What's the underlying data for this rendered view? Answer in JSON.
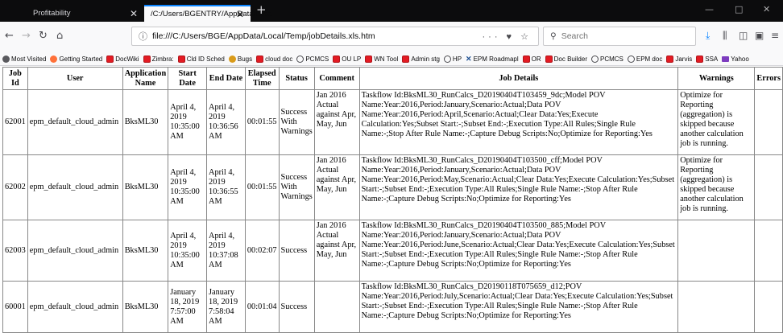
{
  "browser": {
    "tabs": [
      {
        "title": "Profitability"
      },
      {
        "title": "/C:/Users/BGENTRY/AppData/Loca"
      }
    ],
    "new_tab": "+",
    "window_controls": {
      "minimize": "—",
      "maximize": "□",
      "close": "✕"
    },
    "url": "file:///C:/Users/BGE/AppData/Local/Temp/jobDetails.xls.htm",
    "url_actions": "··· ♥ ☆",
    "search_placeholder": "Search",
    "accent": "#0a84ff"
  },
  "bookmarks": [
    {
      "label": "Most Visited",
      "icon": "gear-icon"
    },
    {
      "label": "Getting Started",
      "icon": "firefox-icon"
    },
    {
      "label": "DocWiki",
      "icon": "red-folder-icon"
    },
    {
      "label": "Zimbra:",
      "icon": "red-folder-icon"
    },
    {
      "label": "Cld ID Sched",
      "icon": "red-folder-icon"
    },
    {
      "label": "Bugs",
      "icon": "bug-icon"
    },
    {
      "label": "cloud doc",
      "icon": "red-folder-icon"
    },
    {
      "label": "PCMCS",
      "icon": "globe-icon"
    },
    {
      "label": "OU LP",
      "icon": "red-folder-icon"
    },
    {
      "label": "WN Tool",
      "icon": "red-folder-icon"
    },
    {
      "label": "Admin stg",
      "icon": "red-folder-icon"
    },
    {
      "label": "HP",
      "icon": "globe-icon"
    },
    {
      "label": "EPM Roadmapl",
      "icon": "x-icon"
    },
    {
      "label": "OR",
      "icon": "red-folder-icon"
    },
    {
      "label": "Doc Builder",
      "icon": "red-folder-icon"
    },
    {
      "label": "PCMCS",
      "icon": "globe-icon"
    },
    {
      "label": "EPM doc",
      "icon": "globe-icon"
    },
    {
      "label": "Jarvis",
      "icon": "red-folder-icon"
    },
    {
      "label": "SSA",
      "icon": "red-folder-icon"
    },
    {
      "label": "Yahoo",
      "icon": "mail-icon"
    }
  ],
  "table": {
    "headers": {
      "job_id": "Job Id",
      "user": "User",
      "application_name": "Application Name",
      "start_date": "Start Date",
      "end_date": "End Date",
      "elapsed_time": "Elapsed Time",
      "status": "Status",
      "comment": "Comment",
      "job_details": "Job Details",
      "warnings": "Warnings",
      "errors": "Errors"
    },
    "rows": [
      {
        "job_id": "62001",
        "user": "epm_default_cloud_admin",
        "application_name": "BksML30",
        "start_date": "April 4, 2019 10:35:00 AM",
        "end_date": "April 4, 2019 10:36:56 AM",
        "elapsed_time": "00:01:55",
        "status": "Success With Warnings",
        "comment": "Jan 2016 Actual against Apr, May, Jun",
        "job_details": "Taskflow Id:BksML30_RunCalcs_D20190404T103459_9dc;Model POV Name:Year:2016,Period:January,Scenario:Actual;Data POV Name:Year:2016,Period:April,Scenario:Actual;Clear Data:Yes;Execute Calculation:Yes;Subset Start:-;Subset End:-;Execution Type:All Rules;Single Rule Name:-;Stop After Rule Name:-;Capture Debug Scripts:No;Optimize for Reporting:Yes",
        "warnings": "Optimize for Reporting (aggregation) is skipped because another calculation job is running.",
        "errors": ""
      },
      {
        "job_id": "62002",
        "user": "epm_default_cloud_admin",
        "application_name": "BksML30",
        "start_date": "April 4, 2019 10:35:00 AM",
        "end_date": "April 4, 2019 10:36:55 AM",
        "elapsed_time": "00:01:55",
        "status": "Success With Warnings",
        "comment": "Jan 2016 Actual against Apr, May, Jun",
        "job_details": "Taskflow Id:BksML30_RunCalcs_D20190404T103500_cff;Model POV Name:Year:2016,Period:January,Scenario:Actual;Data POV Name:Year:2016,Period:May,Scenario:Actual;Clear Data:Yes;Execute Calculation:Yes;Subset Start:-;Subset End:-;Execution Type:All Rules;Single Rule Name:-;Stop After Rule Name:-;Capture Debug Scripts:No;Optimize for Reporting:Yes",
        "warnings": "Optimize for Reporting (aggregation) is skipped because another calculation job is running.",
        "errors": ""
      },
      {
        "job_id": "62003",
        "user": "epm_default_cloud_admin",
        "application_name": "BksML30",
        "start_date": "April 4, 2019 10:35:00 AM",
        "end_date": "April 4, 2019 10:37:08 AM",
        "elapsed_time": "00:02:07",
        "status": "Success",
        "comment": "Jan 2016 Actual against Apr, May, Jun",
        "job_details": "Taskflow Id:BksML30_RunCalcs_D20190404T103500_885;Model POV Name:Year:2016,Period:January,Scenario:Actual;Data POV Name:Year:2016,Period:June,Scenario:Actual;Clear Data:Yes;Execute Calculation:Yes;Subset Start:-;Subset End:-;Execution Type:All Rules;Single Rule Name:-;Stop After Rule Name:-;Capture Debug Scripts:No;Optimize for Reporting:Yes",
        "warnings": "",
        "errors": ""
      },
      {
        "job_id": "60001",
        "user": "epm_default_cloud_admin",
        "application_name": "BksML30",
        "start_date": "January 18, 2019 7:57:00 AM",
        "end_date": "January 18, 2019 7:58:04 AM",
        "elapsed_time": "00:01:04",
        "status": "Success",
        "comment": "",
        "job_details": "Taskflow Id:BksML30_RunCalcs_D20190118T075659_d12;POV Name:Year:2016,Period:July,Scenario:Actual;Clear Data:Yes;Execute Calculation:Yes;Subset Start:-;Subset End:-;Execution Type:All Rules;Single Rule Name:-;Stop After Rule Name:-;Capture Debug Scripts:No;Optimize for Reporting:Yes",
        "warnings": "",
        "errors": ""
      }
    ]
  }
}
